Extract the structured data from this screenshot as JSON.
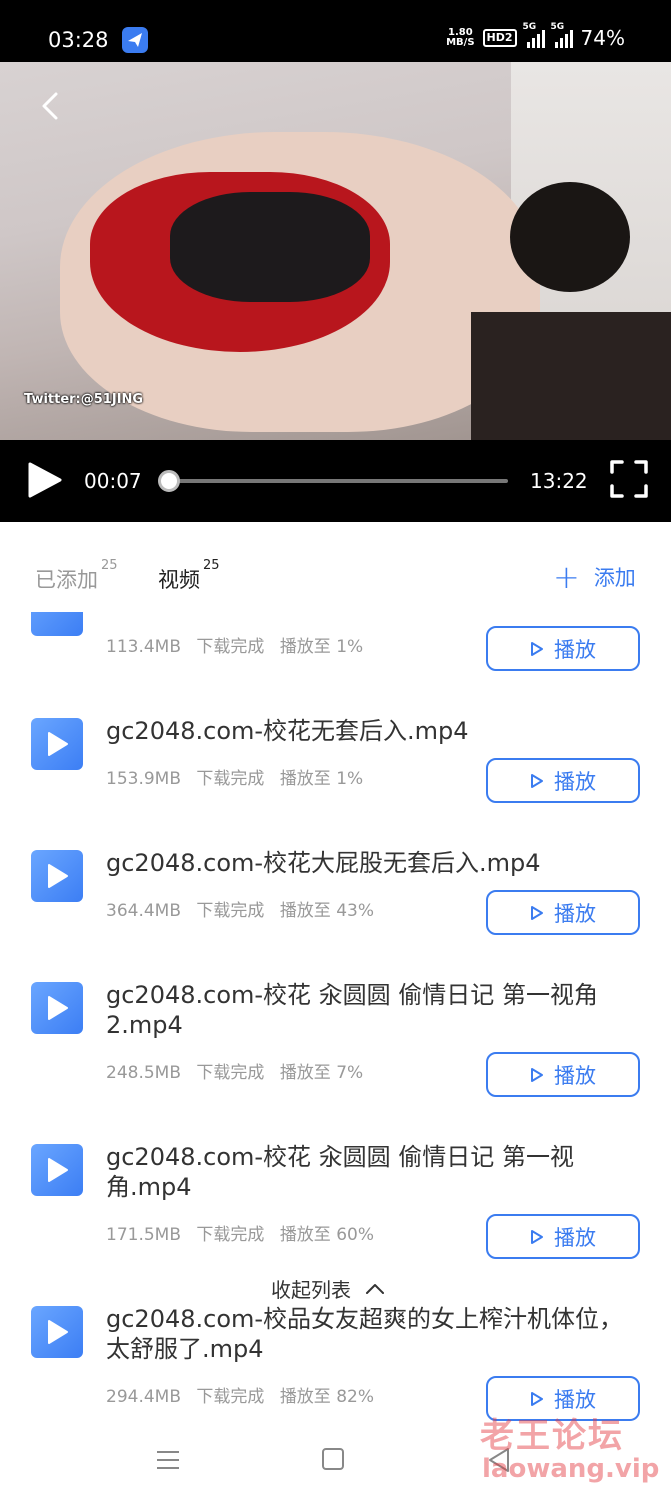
{
  "status_bar": {
    "time": "03:28",
    "net_speed_value": "1.80",
    "net_speed_unit": "MB/S",
    "hd_badge": "HD2",
    "signal_1_label": "5G",
    "signal_2_label": "5G",
    "battery": "74%"
  },
  "player": {
    "watermark": "Twitter:@51JING",
    "current_time": "00:07",
    "total_time": "13:22",
    "progress_fraction": 0.009
  },
  "tabs": {
    "added_label": "已添加",
    "added_count": "25",
    "video_label": "视频",
    "video_count": "25",
    "add_label": "添加"
  },
  "list": {
    "play_label": "播放",
    "items": [
      {
        "title": "",
        "size": "113.4MB",
        "status": "下载完成",
        "progress": "播放至 1%"
      },
      {
        "title": "gc2048.com-校花无套后入.mp4",
        "size": "153.9MB",
        "status": "下载完成",
        "progress": "播放至 1%"
      },
      {
        "title": "gc2048.com-校花大屁股无套后入.mp4",
        "size": "364.4MB",
        "status": "下载完成",
        "progress": "播放至 43%"
      },
      {
        "title": "gc2048.com-校花 汆圆圆 偷情日记 第一视角2.mp4",
        "size": "248.5MB",
        "status": "下载完成",
        "progress": "播放至 7%"
      },
      {
        "title": "gc2048.com-校花 汆圆圆 偷情日记 第一视角.mp4",
        "size": "171.5MB",
        "status": "下载完成",
        "progress": "播放至 60%"
      },
      {
        "title": "gc2048.com-校品女友超爽的女上榨汁机体位，太舒服了.mp4",
        "size": "294.4MB",
        "status": "下载完成",
        "progress": "播放至 82%"
      }
    ]
  },
  "collapse_label": "收起列表",
  "watermark": {
    "logo": "老王论坛",
    "url": "laowang.vip"
  },
  "colors": {
    "accent": "#3b7cf0",
    "watermark": "#e4373d"
  }
}
